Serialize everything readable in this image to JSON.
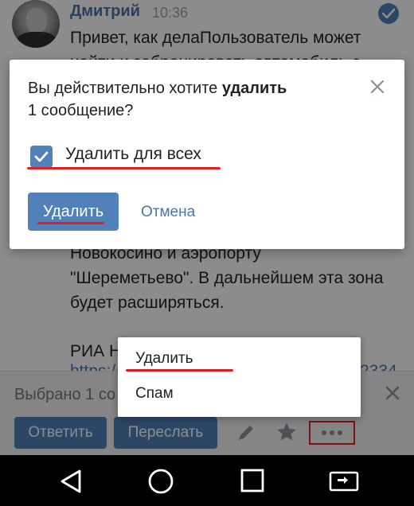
{
  "chat": {
    "sender": "Дмитрий",
    "time": "10:36",
    "message_top": "Привет, как делаПользователь может\nнайти и забронировать автомобиль с",
    "message_mid": "Новокосино и аэропорту\n\"Шереметьево\". В дальнейшем эта зона\nбудет расширяться.",
    "message_riah": "РИА Н",
    "message_link": "https://",
    "message_link2": "2334"
  },
  "dialog": {
    "text_before": "Вы действительно хотите ",
    "text_bold": "удалить",
    "text_after": "1 сообщение?",
    "checkbox_label": "Удалить для всех",
    "checkbox_checked": true,
    "delete_label": "Удалить",
    "cancel_label": "Отмена"
  },
  "menu": {
    "items": [
      {
        "label": "Удалить"
      },
      {
        "label": "Спам"
      }
    ]
  },
  "bottom_bar": {
    "selected_text": "Выбрано 1 со",
    "reply_label": "Ответить",
    "forward_label": "Переслать"
  },
  "colors": {
    "accent": "#5181b8",
    "link": "#4a76a8",
    "highlight": "#e02020"
  },
  "icons": [
    "check-icon",
    "close-icon",
    "pencil-icon",
    "star-icon",
    "more-icon",
    "back-icon",
    "home-icon",
    "recents-icon",
    "screen-rotate-icon"
  ]
}
